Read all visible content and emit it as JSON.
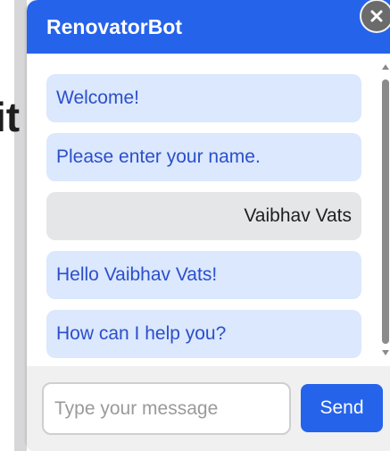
{
  "background": {
    "partial_text": "it"
  },
  "header": {
    "title": "RenovatorBot"
  },
  "close_button": {
    "icon": "close-icon"
  },
  "messages": [
    {
      "sender": "bot",
      "text": "Welcome!"
    },
    {
      "sender": "bot",
      "text": "Please enter your name."
    },
    {
      "sender": "user",
      "text": "Vaibhav Vats"
    },
    {
      "sender": "bot",
      "text": "Hello Vaibhav Vats!"
    },
    {
      "sender": "bot",
      "text": "How can I help you?"
    }
  ],
  "input": {
    "placeholder": "Type your message",
    "value": ""
  },
  "send_button": {
    "label": "Send"
  },
  "colors": {
    "accent": "#2563eb",
    "bot_bubble": "#dbe8fe",
    "bot_text": "#2c4fc9",
    "user_bubble": "#e5e6e8",
    "user_text": "#1f1f1f"
  }
}
